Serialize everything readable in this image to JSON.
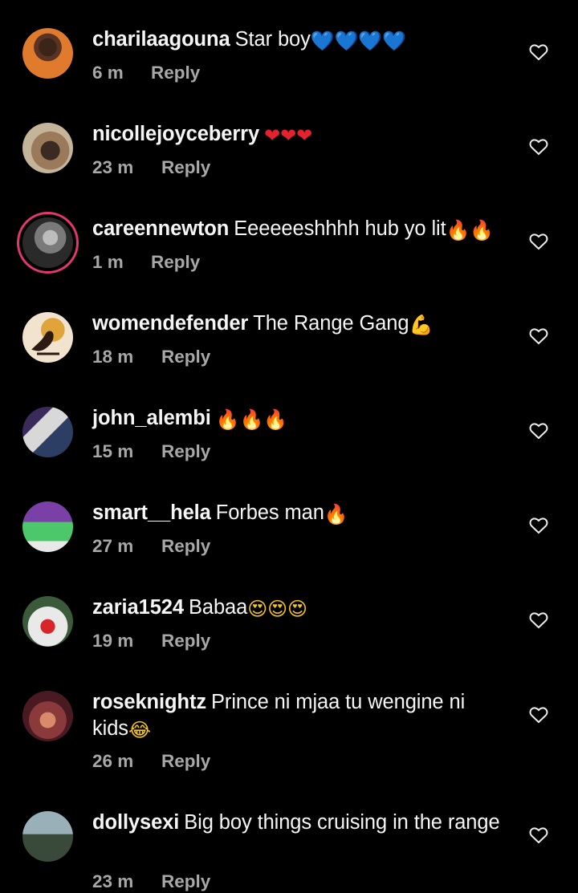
{
  "comments": [
    {
      "username": "charilaagouna",
      "text": "Star boy",
      "emoji": "💙💙💙💙",
      "time": "6 m",
      "reply": "Reply"
    },
    {
      "username": "nicollejoyceberry",
      "text": "",
      "emoji": "❤❤❤",
      "time": "23 m",
      "reply": "Reply"
    },
    {
      "username": "careennewton",
      "text": "Eeeeeeshhhh hub yo lit",
      "emoji": "🔥🔥",
      "time": "1 m",
      "reply": "Reply"
    },
    {
      "username": "womendefender",
      "text": "The Range Gang",
      "emoji": "💪",
      "time": "18 m",
      "reply": "Reply"
    },
    {
      "username": "john_alembi",
      "text": "",
      "emoji": "🔥🔥🔥",
      "time": "15 m",
      "reply": "Reply"
    },
    {
      "username": "smart__hela",
      "text": "Forbes man",
      "emoji": "🔥",
      "time": "27 m",
      "reply": "Reply"
    },
    {
      "username": "zaria1524",
      "text": "Babaa",
      "emoji": "😍😍😍",
      "time": "19 m",
      "reply": "Reply"
    },
    {
      "username": "roseknightz",
      "text": "Prince ni mjaa tu wengine ni kids",
      "emoji": "😂",
      "time": "26 m",
      "reply": "Reply"
    },
    {
      "username": "dollysexi",
      "text": "Big boy things cruising in the range",
      "emoji": "",
      "time": "23 m",
      "reply": "Reply"
    }
  ],
  "colors": {
    "background": "#000000",
    "secondary_text": "#a8a8a8",
    "story_ring": "#e3386f"
  },
  "icons": {
    "like": "heart-outline-icon"
  }
}
